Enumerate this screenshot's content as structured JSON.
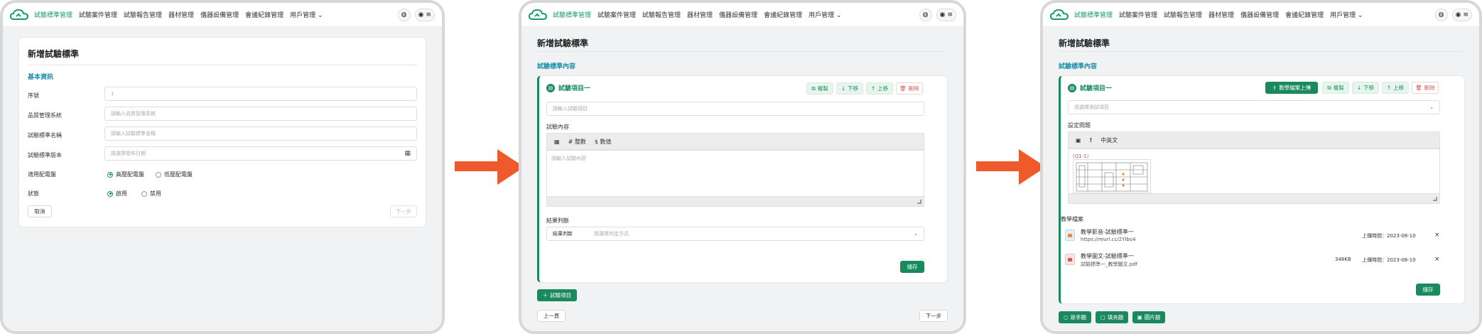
{
  "nav": {
    "items": [
      "試驗標準管理",
      "試驗案件管理",
      "試驗報告管理",
      "器材管理",
      "儀器設備管理",
      "會議紀錄管理",
      "用戶管理"
    ],
    "user_menu_icon": "chevron-down-icon",
    "icons": [
      "globe-icon",
      "user-icon",
      "menu-icon"
    ],
    "accent": "#1a9a6c"
  },
  "screen1": {
    "page_title": "新增試驗標準",
    "section": "基本資訊",
    "fields": {
      "serial": {
        "label": "序號",
        "value": "1"
      },
      "quality": {
        "label": "品質管理系統",
        "placeholder": "請輸入品質管理系統"
      },
      "name": {
        "label": "試驗標準名稱",
        "placeholder": "請輸入試驗標準名稱"
      },
      "version": {
        "label": "試驗標準版本",
        "placeholder": "請選擇發布日期"
      },
      "panel": {
        "label": "適用配電盤",
        "options": [
          "高壓配電盤",
          "低壓配電盤"
        ]
      },
      "status": {
        "label": "狀態",
        "options": [
          "啟用",
          "禁用"
        ]
      }
    },
    "cancel": "取消",
    "next": "下一步"
  },
  "screen2": {
    "page_title": "新增試驗標準",
    "section": "試驗標準內容",
    "item_title": "試驗項目一",
    "actions": [
      "複製",
      "下移",
      "上移",
      "刪除"
    ],
    "item_placeholder": "請輸入試驗項目",
    "content_label": "試驗內容",
    "toolbar": [
      "整數",
      "數值"
    ],
    "content_placeholder": "請輸入試驗內容",
    "result_label": "結果判斷",
    "result_select_label": "結果判斷",
    "result_placeholder": "請選擇判定方式",
    "save": "儲存",
    "add_item": "試驗項目",
    "prev": "上一頁",
    "next": "下一步"
  },
  "screen3": {
    "page_title": "新增試驗標準",
    "section": "試驗標準內容",
    "item_title": "試驗項目一",
    "actions": [
      "教學檔案上傳",
      "複製",
      "下移",
      "上移",
      "刪除"
    ],
    "item_placeholder": "請選擇測試項目",
    "question_label": "設定問題",
    "toolbar": [
      "中英文"
    ],
    "figure_label": "(Q1-1)",
    "teach_label": "教學檔案",
    "files": [
      {
        "name": "教學影音-試驗標準一",
        "sub": "https://reurl.cc/2Ylbo4",
        "size": "",
        "time": "上傳時間：2023-08-10"
      },
      {
        "name": "教學圖文-試驗標準一",
        "sub": "試驗標準一_教學圖文.pdf",
        "size": "348KB",
        "time": "上傳時間：2023-08-10"
      }
    ],
    "save": "儲存",
    "bottom_buttons": [
      "是非題",
      "填充題",
      "圖片題"
    ]
  },
  "colors": {
    "arrow": "#ef5a2c",
    "primary": "#1a8a5e",
    "section": "#1a8fa8",
    "danger": "#d9534f"
  }
}
